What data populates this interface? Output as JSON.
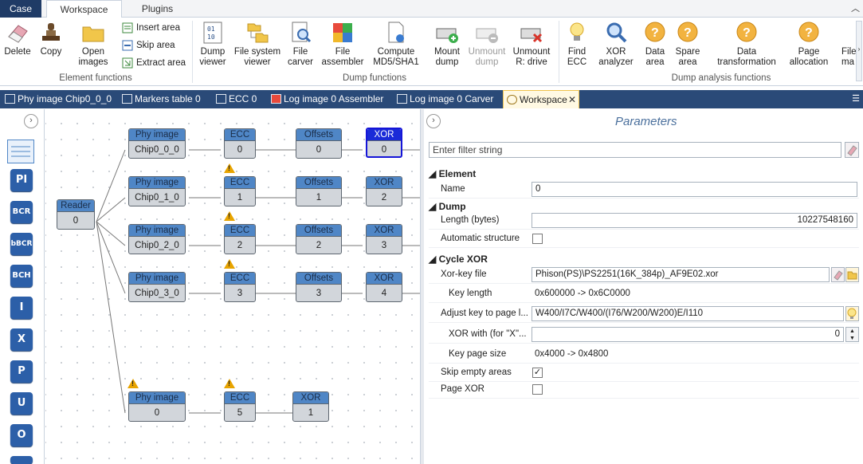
{
  "ribbon_tabs": [
    "Case",
    "Workspace",
    "Plugins"
  ],
  "ribbon": {
    "delete": "Delete",
    "copy": "Copy",
    "open_images": [
      "Open",
      "images"
    ],
    "insert_area": "Insert area",
    "skip_area": "Skip area",
    "extract_area": "Extract area",
    "group_element": "Element functions",
    "dump_viewer": [
      "Dump",
      "viewer"
    ],
    "fs_viewer": [
      "File system",
      "viewer"
    ],
    "file_carver": [
      "File",
      "carver"
    ],
    "file_assembler": [
      "File",
      "assembler"
    ],
    "compute_md5": [
      "Compute",
      "MD5/SHA1"
    ],
    "mount_dump": [
      "Mount",
      "dump"
    ],
    "unmount_dump": [
      "Unmount",
      "dump"
    ],
    "unmount_r": [
      "Unmount",
      "R: drive"
    ],
    "group_dump": "Dump functions",
    "find_ecc": [
      "Find",
      "ECC"
    ],
    "xor_analyzer": [
      "XOR",
      "analyzer"
    ],
    "data_area": [
      "Data",
      "area"
    ],
    "spare_area": [
      "Spare",
      "area"
    ],
    "data_transformation": [
      "Data",
      "transformation"
    ],
    "page_allocation": [
      "Page",
      "allocation"
    ],
    "file_more": [
      "File",
      "ma"
    ],
    "group_analysis": "Dump analysis functions"
  },
  "doc_tabs": [
    "Phy image Chip0_0_0",
    "Markers table 0",
    "ECC 0",
    "Log image 0 Assembler",
    "Log image 0 Carver",
    "Workspace"
  ],
  "left_tools": [
    "PI",
    "BCR",
    "bBCR",
    "BCH",
    "I",
    "X",
    "P",
    "U",
    "O"
  ],
  "graph": {
    "reader": {
      "title": "Reader",
      "value": "0"
    },
    "rows": [
      {
        "phy": "Chip0_0_0",
        "ecc": "0",
        "offsets": "0",
        "xor": "0"
      },
      {
        "phy": "Chip0_1_0",
        "ecc": "1",
        "offsets": "1",
        "xor": "2"
      },
      {
        "phy": "Chip0_2_0",
        "ecc": "2",
        "offsets": "2",
        "xor": "3"
      },
      {
        "phy": "Chip0_3_0",
        "ecc": "3",
        "offsets": "3",
        "xor": "4"
      }
    ],
    "last": {
      "phy": "0",
      "ecc": "5",
      "xor": "1"
    },
    "labels": {
      "phy": "Phy image",
      "ecc": "ECC",
      "offsets": "Offsets",
      "xor": "XOR"
    }
  },
  "params": {
    "title": "Parameters",
    "filter_placeholder": "Enter filter string",
    "sections": {
      "element": "Element",
      "dump": "Dump",
      "cycle_xor": "Cycle XOR"
    },
    "name_label": "Name",
    "name_value": "0",
    "length_label": "Length (bytes)",
    "length_value": "10227548160",
    "auto_struct_label": "Automatic structure",
    "auto_struct": false,
    "xorkey_label": "Xor-key file",
    "xorkey_value": "Phison(PS)\\PS2251(16K_384p)_AF9E02.xor",
    "keylen_label": "Key length",
    "keylen_value": "0x600000 -> 0x6C0000",
    "adjust_label": "Adjust key to page l...",
    "adjust_value": "W400/I7C/W400/(I76/W200/W200)E/I110",
    "xorwith_label": "XOR with (for \"X\"...",
    "xorwith_value": "0",
    "keypage_label": "Key page size",
    "keypage_value": "0x4000 -> 0x4800",
    "skip_empty_label": "Skip empty areas",
    "skip_empty": true,
    "page_xor_label": "Page XOR",
    "page_xor": false
  }
}
